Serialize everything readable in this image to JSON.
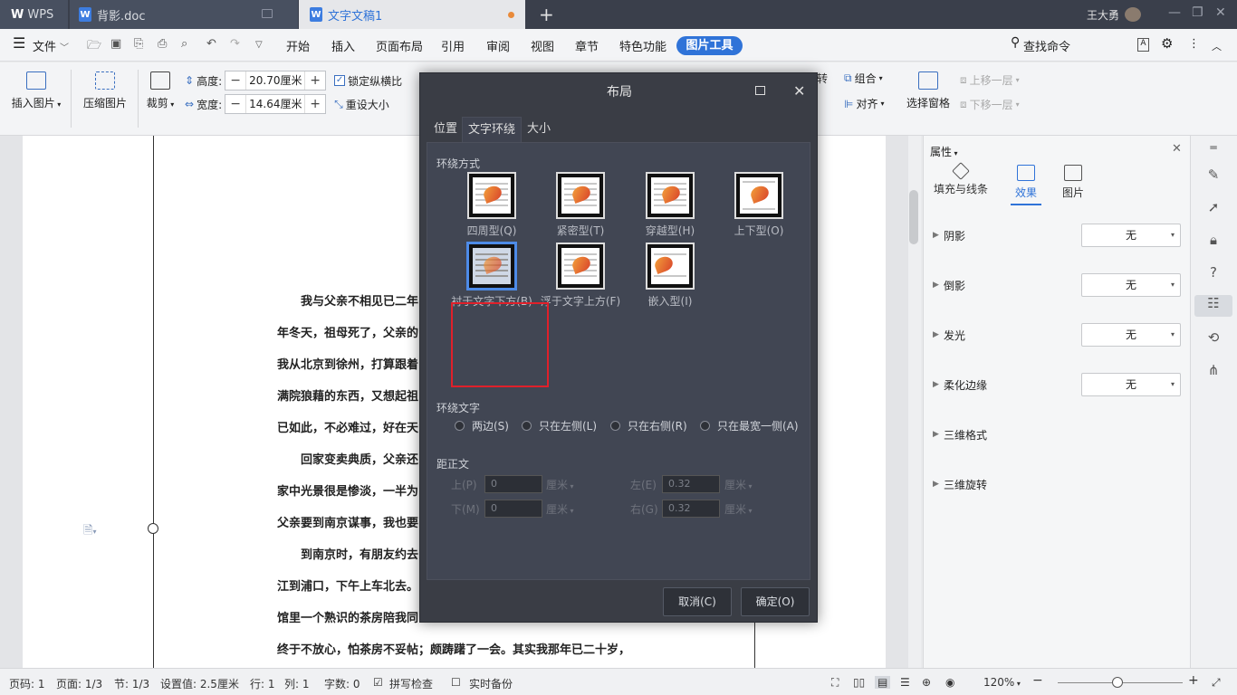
{
  "titlebar": {
    "app_tab": "WPS",
    "doc1_tab": "背影.doc",
    "doc2_tab": "文字文稿1",
    "new_tab": "+",
    "user_name": "王大勇"
  },
  "menubar": {
    "file": "文件",
    "items": [
      "开始",
      "插入",
      "页面布局",
      "引用",
      "审阅",
      "视图",
      "章节",
      "特色功能"
    ],
    "active": "图片工具",
    "search": "查找命令"
  },
  "ribbon": {
    "insert_picture": "插入图片",
    "compress_picture": "压缩图片",
    "crop": "裁剪",
    "height_label": "高度:",
    "height_value": "20.70厘米",
    "width_label": "宽度:",
    "width_value": "14.64厘米",
    "lock_ratio": "锁定纵横比",
    "reset_size": "重设大小",
    "rotate_partial": "转",
    "group": "组合",
    "align": "对齐",
    "select_pane": "选择窗格",
    "bring_forward": "上移一层",
    "send_backward": "下移一层"
  },
  "document": {
    "lines": [
      "我与父亲不相见已二年",
      "年冬天，祖母死了，父亲的",
      "我从北京到徐州，打算跟着",
      "满院狼藉的东西，又想起祖",
      "已如此，不必难过，好在天",
      "回家变卖典质，父亲还",
      "家中光景很是惨淡，一半为",
      "父亲要到南京谋事，我也要",
      "到南京时，有朋友约去",
      "江到浦口，下午上车北去。",
      "馆里一个熟识的茶房陪我同",
      "终于不放心，怕茶房不妥帖；颇踌躇了一会。其实我那年已二十岁，"
    ]
  },
  "dialog": {
    "title": "布局",
    "tabs": [
      "位置",
      "文字环绕",
      "大小"
    ],
    "wrap_section": "环绕方式",
    "wrap_options": [
      "四周型(Q)",
      "紧密型(T)",
      "穿越型(H)",
      "上下型(O)",
      "衬于文字下方(B)",
      "浮于文字上方(F)",
      "嵌入型(I)"
    ],
    "wrap_text_section": "环绕文字",
    "wrap_text_options": [
      "两边(S)",
      "只在左侧(L)",
      "只在右侧(R)",
      "只在最宽一侧(A)"
    ],
    "distance_section": "距正文",
    "distance": {
      "top_label": "上(P)",
      "top_value": "0",
      "bottom_label": "下(M)",
      "bottom_value": "0",
      "left_label": "左(E)",
      "left_value": "0.32",
      "right_label": "右(G)",
      "right_value": "0.32",
      "unit": "厘米"
    },
    "cancel": "取消(C)",
    "ok": "确定(O)"
  },
  "panel": {
    "title": "属性",
    "tabs": [
      "填充与线条",
      "效果",
      "图片"
    ],
    "rows": [
      {
        "label": "阴影",
        "value": "无"
      },
      {
        "label": "倒影",
        "value": "无"
      },
      {
        "label": "发光",
        "value": "无"
      },
      {
        "label": "柔化边缘",
        "value": "无"
      },
      {
        "label": "三维格式",
        "value": ""
      },
      {
        "label": "三维旋转",
        "value": ""
      }
    ]
  },
  "status": {
    "page_code": "页码: 1",
    "page": "页面: 1/3",
    "section": "节: 1/3",
    "setting": "设置值: 2.5厘米",
    "row": "行: 1",
    "col": "列: 1",
    "words": "字数: 0",
    "spell": "拼写检查",
    "backup": "实时备份",
    "zoom": "120%"
  },
  "colors": {
    "accent": "#2f73d8",
    "highlight": "#e0202a"
  }
}
